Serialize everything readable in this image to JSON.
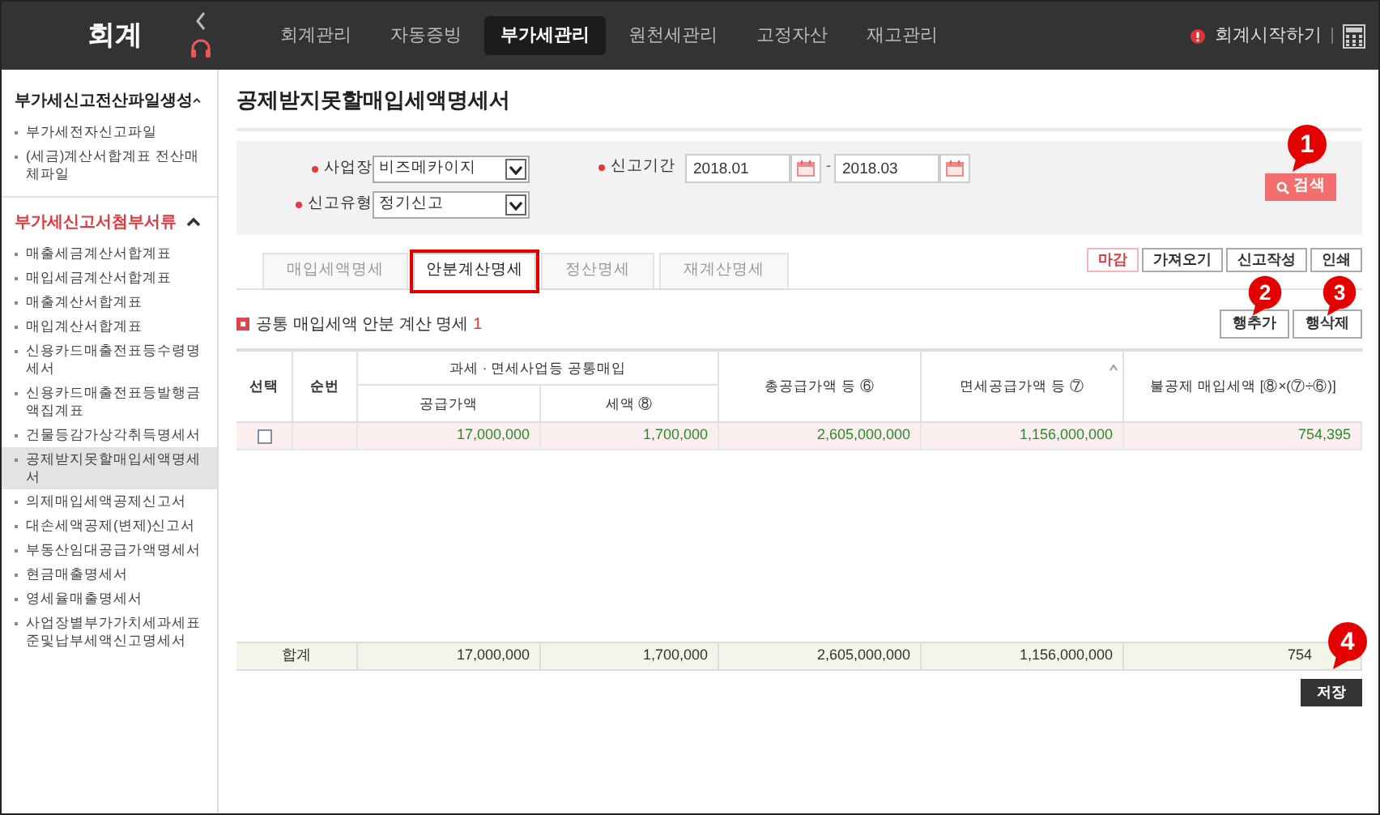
{
  "app": {
    "title": "회계"
  },
  "nav": [
    {
      "label": "회계관리",
      "selected": false
    },
    {
      "label": "자동증빙",
      "selected": false
    },
    {
      "label": "부가세관리",
      "selected": true
    },
    {
      "label": "원천세관리",
      "selected": false
    },
    {
      "label": "고정자산",
      "selected": false
    },
    {
      "label": "재고관리",
      "selected": false
    }
  ],
  "header_link": "회계시작하기",
  "sidebar": {
    "sections": [
      {
        "title": "부가세신고전산파일생성",
        "active": false,
        "expanded": true,
        "items": [
          {
            "label": "부가세전자신고파일",
            "selected": false
          },
          {
            "label": "(세금)계산서합계표 전산매체파일",
            "selected": false
          }
        ]
      },
      {
        "title": "부가세신고서첨부서류",
        "active": true,
        "expanded": true,
        "items": [
          {
            "label": "매출세금계산서합계표",
            "selected": false
          },
          {
            "label": "매입세금계산서합계표",
            "selected": false
          },
          {
            "label": "매출계산서합계표",
            "selected": false
          },
          {
            "label": "매입계산서합계표",
            "selected": false
          },
          {
            "label": "신용카드매출전표등수령명세서",
            "selected": false
          },
          {
            "label": "신용카드매출전표등발행금액집계표",
            "selected": false
          },
          {
            "label": "건물등감가상각취득명세서",
            "selected": false
          },
          {
            "label": "공제받지못할매입세액명세서",
            "selected": true
          },
          {
            "label": "의제매입세액공제신고서",
            "selected": false
          },
          {
            "label": "대손세액공제(변제)신고서",
            "selected": false
          },
          {
            "label": "부동산임대공급가액명세서",
            "selected": false
          },
          {
            "label": "현금매출명세서",
            "selected": false
          },
          {
            "label": "영세율매출명세서",
            "selected": false
          },
          {
            "label": "사업장별부가가치세과세표준및납부세액신고명세서",
            "selected": false
          }
        ]
      }
    ]
  },
  "page_title": "공제받지못할매입세액명세서",
  "filters": [
    {
      "kind": "select",
      "label": "사업장",
      "required": true,
      "value": "비즈메카이지"
    },
    {
      "kind": "period",
      "label": "신고기간",
      "required": true,
      "from": "2018.01",
      "separator": "-",
      "to": "2018.03"
    },
    {
      "kind": "select",
      "label": "신고유형",
      "required": true,
      "value": "정기신고"
    }
  ],
  "search_button": "검색",
  "tabs": [
    {
      "label": "매입세액명세",
      "selected": false,
      "highlighted": false
    },
    {
      "label": "안분계산명세",
      "selected": true,
      "highlighted": true
    },
    {
      "label": "정산명세",
      "selected": false,
      "highlighted": false
    },
    {
      "label": "재계산명세",
      "selected": false,
      "highlighted": false
    }
  ],
  "actions": [
    {
      "label": "마감",
      "kind": "accent"
    },
    {
      "label": "가져오기",
      "kind": "normal"
    },
    {
      "label": "신고작성",
      "kind": "normal"
    },
    {
      "label": "인쇄",
      "kind": "normal"
    }
  ],
  "section": {
    "title": "공통 매입세액 안분 계산 명세",
    "count": "1"
  },
  "row_buttons": [
    "행추가",
    "행삭제"
  ],
  "table": {
    "header_group": "과세 · 면세사업등 공통매입",
    "columns": [
      "선택",
      "순번",
      "공급가액",
      "세액 ⑧",
      "총공급가액 등 ⑥",
      "면세공급가액 등 ⑦",
      "불공제 매입세액 [⑧×(⑦÷⑥)]"
    ],
    "rows": [
      {
        "checked": false,
        "cells": [
          "",
          "",
          "17,000,000",
          "1,700,000",
          "2,605,000,000",
          "1,156,000,000",
          "754,395"
        ]
      }
    ],
    "total": {
      "label": "합계",
      "cells": [
        "17,000,000",
        "1,700,000",
        "2,605,000,000",
        "1,156,000,000",
        "754"
      ]
    }
  },
  "save_button": "저장",
  "callouts": [
    "1",
    "2",
    "3",
    "4"
  ]
}
